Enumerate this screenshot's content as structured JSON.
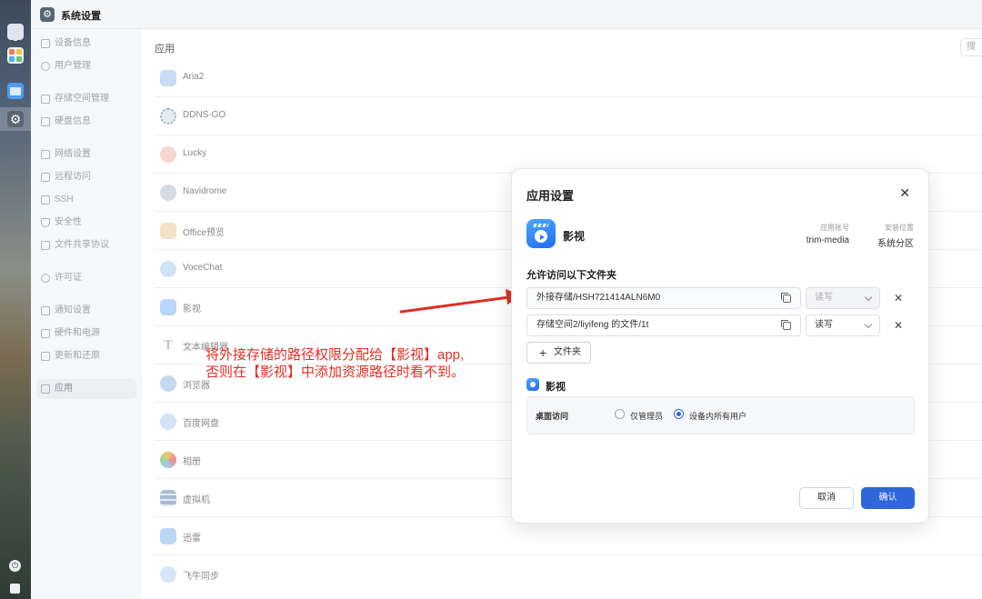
{
  "window": {
    "title": "系统设置"
  },
  "sidebar": {
    "items": [
      {
        "label": "设备信息"
      },
      {
        "label": "用户管理"
      },
      {
        "label": "存储空间管理"
      },
      {
        "label": "硬盘信息"
      },
      {
        "label": "网络设置"
      },
      {
        "label": "远程访问"
      },
      {
        "label": "SSH"
      },
      {
        "label": "安全性"
      },
      {
        "label": "文件共享协议"
      },
      {
        "label": "许可证"
      },
      {
        "label": "通知设置"
      },
      {
        "label": "硬件和电源"
      },
      {
        "label": "更新和还原"
      },
      {
        "label": "应用"
      }
    ],
    "active": "应用"
  },
  "main": {
    "heading": "应用",
    "search_placeholder": "搜",
    "apps": [
      {
        "name": "Aria2"
      },
      {
        "name": "DDNS-GO"
      },
      {
        "name": "Lucky"
      },
      {
        "name": "Navidrome"
      },
      {
        "name": "Office预览"
      },
      {
        "name": "VoceChat"
      },
      {
        "name": "影视"
      },
      {
        "name": "文本编辑器"
      },
      {
        "name": "浏览器"
      },
      {
        "name": "百度网盘"
      },
      {
        "name": "相册"
      },
      {
        "name": "虚拟机"
      },
      {
        "name": "迅雷"
      },
      {
        "name": "飞牛同步"
      }
    ]
  },
  "annotation": {
    "line1": "将外接存储的路径权限分配给【影视】app,",
    "line2": "否则在【影视】中添加资源路径时看不到。",
    "color": "#e02e24"
  },
  "dialog": {
    "title": "应用设置",
    "app_name": "影视",
    "account_label": "应用账号",
    "account_value": "trim-media",
    "location_label": "安装位置",
    "location_value": "系统分区",
    "section_title": "允许访问以下文件夹",
    "folders": [
      {
        "path": "外接存储/HSH721414ALN6M0",
        "permission": "读写"
      },
      {
        "path": "存储空间2/liyifeng 的文件/1t",
        "permission": "读写"
      }
    ],
    "add_folder_label": "文件夹",
    "sub_title": "影视",
    "desktop_access_label": "桌面访问",
    "options": [
      {
        "label": "仅管理员",
        "checked": false
      },
      {
        "label": "设备内所有用户",
        "checked": true
      }
    ],
    "cancel_label": "取消",
    "confirm_label": "确认",
    "accent": "#2f66d8"
  }
}
